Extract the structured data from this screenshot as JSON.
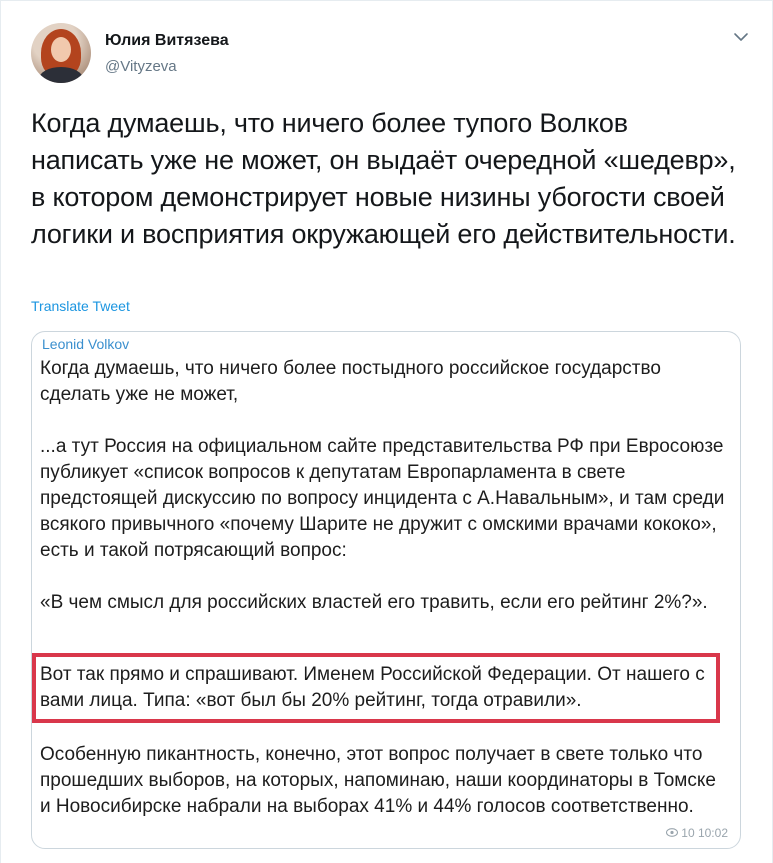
{
  "author": {
    "name": "Юлия Витязева",
    "handle": "@Vityzeva"
  },
  "tweet": {
    "text": "Когда думаешь, что ничего более тупого  Волков написать уже не может, он выдаёт очередной «шедевр», в котором демонстрирует новые низины убогости своей логики и восприятия окружающей его действительности.",
    "translate_label": "Translate Tweet"
  },
  "quote": {
    "author": "Leonid Volkov",
    "paragraphs": [
      "Когда думаешь, что ничего более постыдного российское государство сделать уже не может,",
      "...а тут Россия на официальном сайте представительства РФ при Евросоюзе публикует «список вопросов к депутатам Европарламента в свете предстоящей дискуссию по вопросу инцидента с А.Навальным», и там среди всякого привычного «почему Шарите не дружит с омскими врачами кококо», есть и такой потрясающий вопрос:",
      "«В чем смысл для российских властей его травить, если его рейтинг 2%?».",
      "Вот так прямо и спрашивают. Именем Российской Федерации. От нашего с вами лица. Типа: «вот был бы 20% рейтинг, тогда отравили».",
      "Особенную пикантность, конечно, этот вопрос получает в свете только что прошедших выборов, на которых, напоминаю, наши координаторы в Томске и Новосибирске набрали на выборах 41% и 44% голосов соответственно."
    ],
    "views_time": "10 10:02"
  },
  "icons": {
    "caret": "chevron-down-icon",
    "views": "eye-icon"
  },
  "colors": {
    "link": "#1b95e0",
    "highlight_border": "#d9374b",
    "secondary_text": "#657786"
  }
}
